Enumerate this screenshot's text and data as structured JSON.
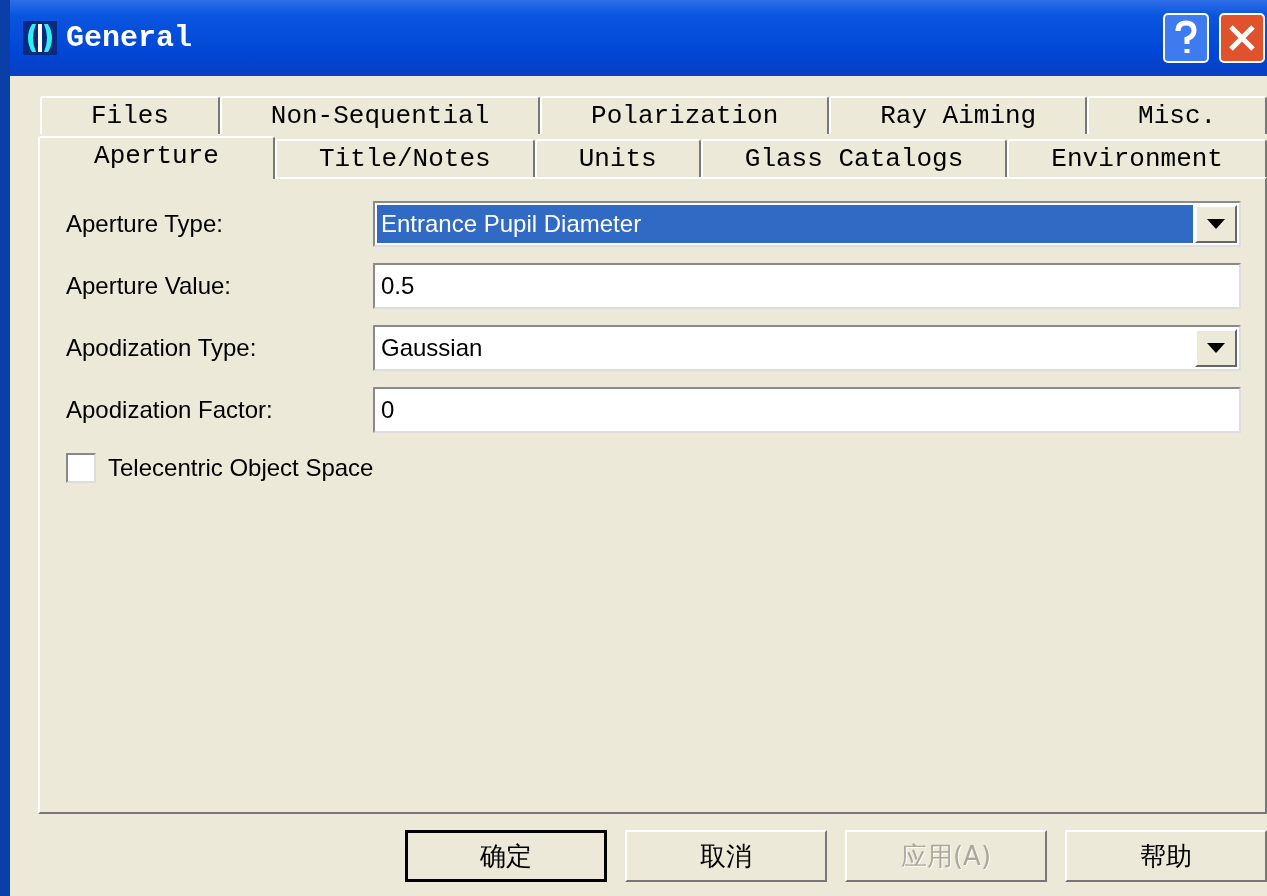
{
  "window": {
    "title": "General"
  },
  "tab_rows": [
    [
      {
        "label": "Files",
        "selected": false
      },
      {
        "label": "Non-Sequential",
        "selected": false
      },
      {
        "label": "Polarization",
        "selected": false
      },
      {
        "label": "Ray Aiming",
        "selected": false
      },
      {
        "label": "Misc.",
        "selected": false
      }
    ],
    [
      {
        "label": "Aperture",
        "selected": true
      },
      {
        "label": "Title/Notes",
        "selected": false
      },
      {
        "label": "Units",
        "selected": false
      },
      {
        "label": "Glass Catalogs",
        "selected": false
      },
      {
        "label": "Environment",
        "selected": false
      }
    ]
  ],
  "fields": [
    {
      "kind": "dropdown",
      "label": "Aperture Type:",
      "value": "Entrance Pupil Diameter",
      "highlighted": true
    },
    {
      "kind": "text",
      "label": "Aperture Value:",
      "value": "0.5",
      "highlighted": false
    },
    {
      "kind": "dropdown",
      "label": "Apodization Type:",
      "value": "Gaussian",
      "highlighted": false
    },
    {
      "kind": "text",
      "label": "Apodization Factor:",
      "value": "0",
      "highlighted": false
    }
  ],
  "checkbox": {
    "label": "Telecentric Object Space",
    "checked": false
  },
  "buttons": [
    {
      "label": "确定",
      "default": true,
      "disabled": false
    },
    {
      "label": "取消",
      "default": false,
      "disabled": false
    },
    {
      "label": "应用(A)",
      "default": false,
      "disabled": true
    },
    {
      "label": "帮助",
      "default": false,
      "disabled": false
    }
  ]
}
